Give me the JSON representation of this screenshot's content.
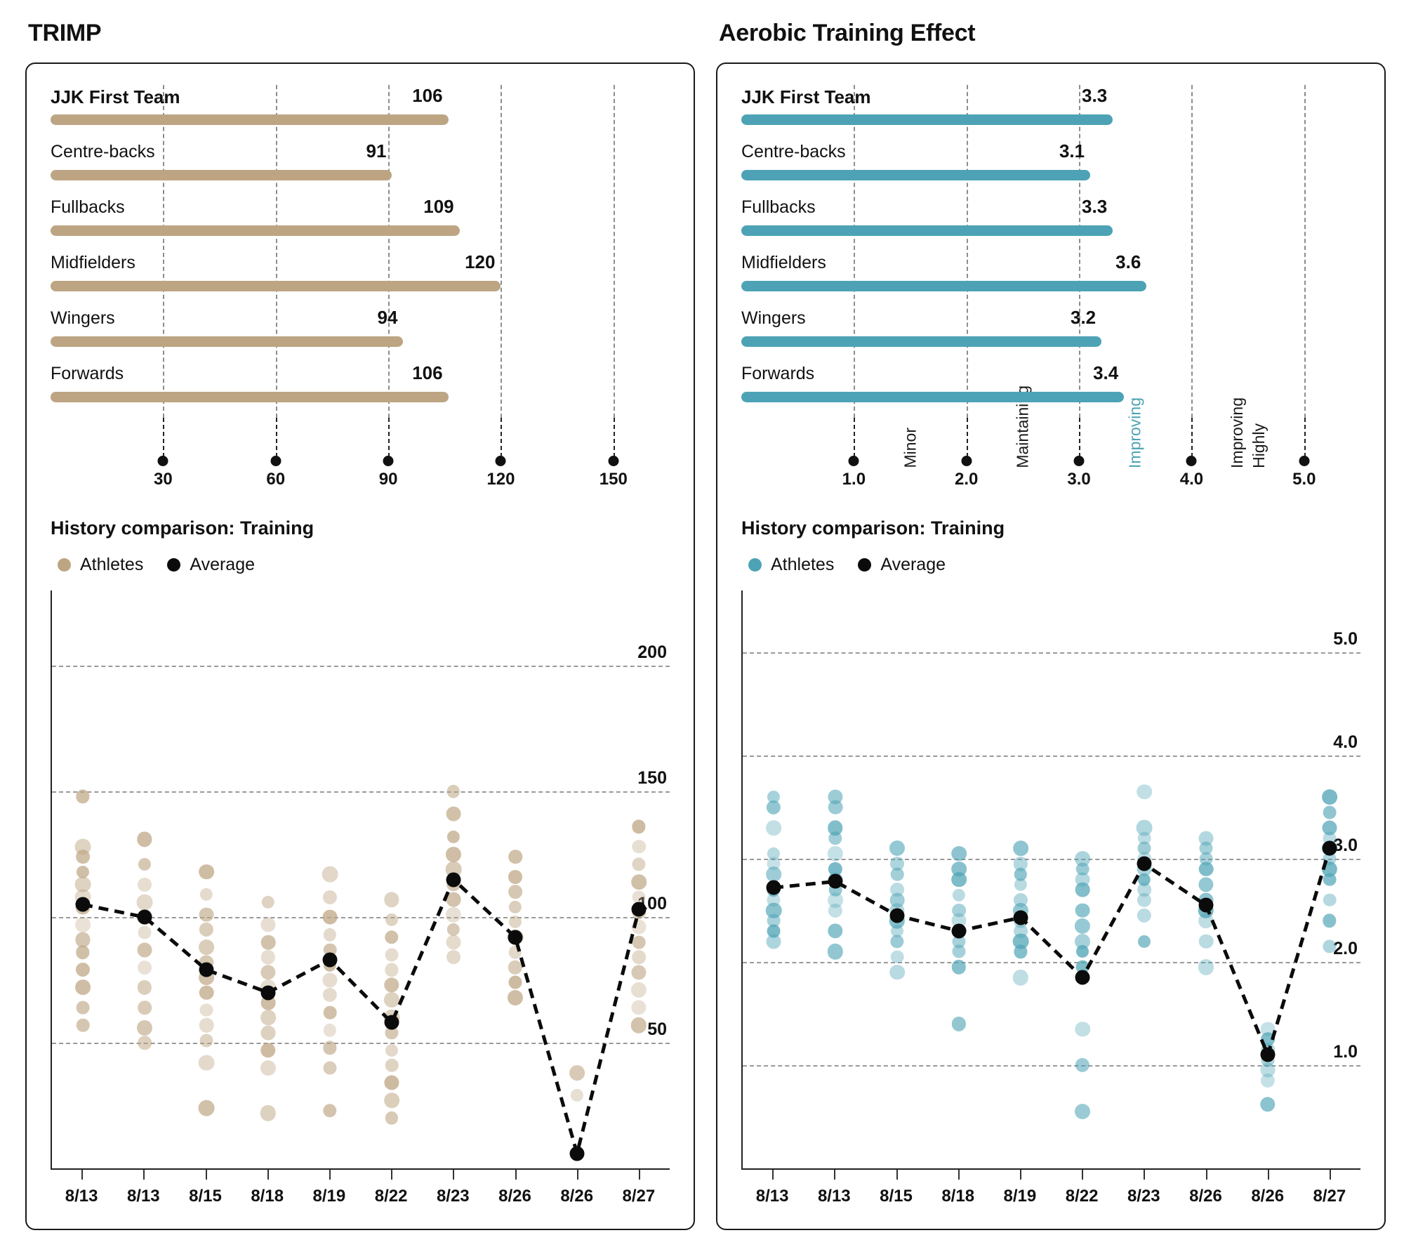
{
  "colors": {
    "trimp_accent": "#bda583",
    "ate_accent": "#4da3b5",
    "average": "#0b0b0b",
    "border": "#1a1a1a",
    "grid": "#9a9a9a"
  },
  "panels": [
    {
      "id": "trimp",
      "title": "TRIMP",
      "accent": "#bda583",
      "bullet": {
        "axis_min": 0,
        "axis_max": 165,
        "ticks": [
          30,
          60,
          90,
          120,
          150
        ],
        "tick_labels": [
          "30",
          "60",
          "90",
          "120",
          "150"
        ],
        "zone_labels": [],
        "rows": [
          {
            "label": "JJK First Team",
            "value": 106,
            "value_label": "106",
            "bold": true
          },
          {
            "label": "Centre-backs",
            "value": 91,
            "value_label": "91",
            "bold": false
          },
          {
            "label": "Fullbacks",
            "value": 109,
            "value_label": "109",
            "bold": false
          },
          {
            "label": "Midfielders",
            "value": 120,
            "value_label": "120",
            "bold": false
          },
          {
            "label": "Wingers",
            "value": 94,
            "value_label": "94",
            "bold": false
          },
          {
            "label": "Forwards",
            "value": 106,
            "value_label": "106",
            "bold": false
          }
        ]
      },
      "history": {
        "title": "History comparison: Training",
        "legend": [
          {
            "label": "Athletes",
            "color": "#bda583"
          },
          {
            "label": "Average",
            "color": "#0b0b0b"
          }
        ],
        "ylim": [
          0,
          230
        ],
        "gridlines": [
          200,
          150,
          100,
          50
        ],
        "gridline_labels": [
          "200",
          "150",
          "100",
          "50"
        ],
        "dates": [
          "8/13",
          "8/13",
          "8/15",
          "8/18",
          "8/19",
          "8/22",
          "8/23",
          "8/26",
          "8/26",
          "8/27"
        ],
        "average": [
          105,
          100,
          79,
          70,
          83,
          58,
          115,
          92,
          6,
          103
        ],
        "athletes": [
          [
            148,
            128,
            124,
            118,
            113,
            108,
            104,
            97,
            91,
            86,
            79,
            72,
            64,
            57
          ],
          [
            131,
            121,
            113,
            106,
            100,
            94,
            87,
            80,
            72,
            64,
            56,
            50
          ],
          [
            118,
            109,
            101,
            95,
            88,
            82,
            76,
            70,
            63,
            57,
            51,
            42,
            24
          ],
          [
            106,
            97,
            90,
            84,
            78,
            72,
            66,
            60,
            54,
            47,
            40,
            22
          ],
          [
            117,
            108,
            100,
            93,
            87,
            81,
            75,
            69,
            62,
            55,
            48,
            40,
            23
          ],
          [
            107,
            99,
            92,
            85,
            79,
            73,
            67,
            60,
            54,
            47,
            41,
            34,
            27,
            20
          ],
          [
            150,
            141,
            132,
            125,
            119,
            113,
            107,
            101,
            95,
            90,
            84
          ],
          [
            124,
            116,
            110,
            104,
            98,
            92,
            86,
            80,
            74,
            68
          ],
          [
            38,
            29
          ],
          [
            136,
            128,
            121,
            114,
            108,
            102,
            96,
            90,
            84,
            78,
            71,
            64,
            57
          ]
        ]
      }
    },
    {
      "id": "aerobic-training-effect",
      "title": "Aerobic Training Effect",
      "accent": "#4da3b5",
      "bullet": {
        "axis_min": 0,
        "axis_max": 5.5,
        "ticks": [
          1.0,
          2.0,
          3.0,
          4.0,
          5.0
        ],
        "tick_labels": [
          "1.0",
          "2.0",
          "3.0",
          "4.0",
          "5.0"
        ],
        "zone_labels": [
          {
            "text": "Minor",
            "at": 1.5,
            "accent": false,
            "lines": [
              "Minor"
            ]
          },
          {
            "text": "Maintaining",
            "at": 2.5,
            "accent": false,
            "lines": [
              "Maintaining"
            ]
          },
          {
            "text": "Improving",
            "at": 3.5,
            "accent": true,
            "lines": [
              "Improving"
            ]
          },
          {
            "text": "Highly Improving",
            "at": 4.5,
            "accent": false,
            "lines": [
              "Highly",
              "Improving"
            ]
          }
        ],
        "rows": [
          {
            "label": "JJK First Team",
            "value": 3.3,
            "value_label": "3.3",
            "bold": true
          },
          {
            "label": "Centre-backs",
            "value": 3.1,
            "value_label": "3.1",
            "bold": false
          },
          {
            "label": "Fullbacks",
            "value": 3.3,
            "value_label": "3.3",
            "bold": false
          },
          {
            "label": "Midfielders",
            "value": 3.6,
            "value_label": "3.6",
            "bold": false
          },
          {
            "label": "Wingers",
            "value": 3.2,
            "value_label": "3.2",
            "bold": false
          },
          {
            "label": "Forwards",
            "value": 3.4,
            "value_label": "3.4",
            "bold": false
          }
        ]
      },
      "history": {
        "title": "History comparison: Training",
        "legend": [
          {
            "label": "Athletes",
            "color": "#4da3b5"
          },
          {
            "label": "Average",
            "color": "#0b0b0b"
          }
        ],
        "ylim": [
          0,
          5.6
        ],
        "gridlines": [
          5.0,
          4.0,
          3.0,
          2.0,
          1.0
        ],
        "gridline_labels": [
          "5.0",
          "4.0",
          "3.0",
          "2.0",
          "1.0"
        ],
        "dates": [
          "8/13",
          "8/13",
          "8/15",
          "8/18",
          "8/19",
          "8/22",
          "8/23",
          "8/26",
          "8/26",
          "8/27"
        ],
        "average": [
          2.72,
          2.78,
          2.45,
          2.3,
          2.43,
          1.85,
          2.95,
          2.55,
          1.1,
          3.1
        ],
        "athletes": [
          [
            3.6,
            3.5,
            3.3,
            3.05,
            2.95,
            2.85,
            2.7,
            2.6,
            2.5,
            2.4,
            2.3,
            2.2
          ],
          [
            3.6,
            3.5,
            3.3,
            3.2,
            3.05,
            2.9,
            2.8,
            2.7,
            2.6,
            2.5,
            2.3,
            2.1
          ],
          [
            3.1,
            2.95,
            2.85,
            2.7,
            2.6,
            2.5,
            2.4,
            2.3,
            2.2,
            2.05,
            1.9
          ],
          [
            3.05,
            2.9,
            2.8,
            2.65,
            2.5,
            2.4,
            2.3,
            2.2,
            2.1,
            1.95,
            1.4
          ],
          [
            3.1,
            2.95,
            2.85,
            2.75,
            2.6,
            2.5,
            2.4,
            2.3,
            2.2,
            2.1,
            1.85
          ],
          [
            3.0,
            2.9,
            2.8,
            2.7,
            2.5,
            2.35,
            2.2,
            2.1,
            1.95,
            1.35,
            1.0,
            0.55
          ],
          [
            3.65,
            3.3,
            3.2,
            3.1,
            3.0,
            2.9,
            2.8,
            2.7,
            2.6,
            2.45,
            2.2
          ],
          [
            3.2,
            3.1,
            3.0,
            2.9,
            2.75,
            2.6,
            2.5,
            2.4,
            2.2,
            1.95
          ],
          [
            1.35,
            1.25,
            1.15,
            1.05,
            0.95,
            0.85,
            0.62
          ],
          [
            3.6,
            3.45,
            3.3,
            3.2,
            3.1,
            3.0,
            2.9,
            2.8,
            2.6,
            2.4,
            2.15
          ]
        ]
      }
    }
  ]
}
